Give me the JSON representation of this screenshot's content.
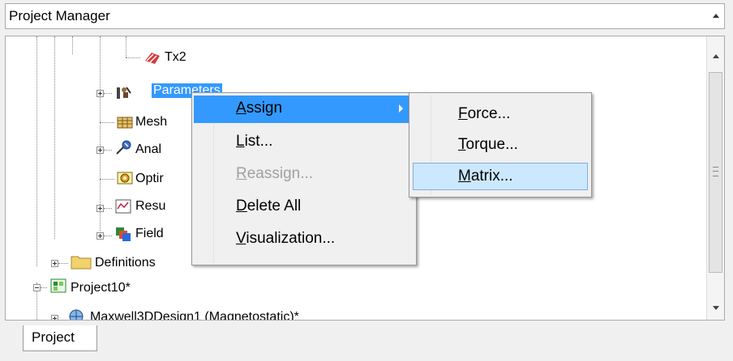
{
  "header": {
    "title": "Project Manager"
  },
  "tree": {
    "items": [
      {
        "label": "Tx2"
      },
      {
        "label": "Parameters"
      },
      {
        "label": "Mesh"
      },
      {
        "label": "Anal"
      },
      {
        "label": "Optir"
      },
      {
        "label": "Resu"
      },
      {
        "label": "Field"
      },
      {
        "label": "Definitions"
      },
      {
        "label": "Project10*"
      },
      {
        "label": "Maxwell3DDesign1 (Magnetostatic)*"
      }
    ]
  },
  "context_menu": {
    "items": [
      {
        "label": "Assign",
        "mnemonic": "A",
        "rest": "ssign",
        "state": "highlighted",
        "has_submenu": true
      },
      {
        "label": "List...",
        "mnemonic": "L",
        "rest": "ist...",
        "state": "normal"
      },
      {
        "label": "Reassign...",
        "mnemonic": "R",
        "rest": "eassign...",
        "state": "disabled"
      },
      {
        "label": "Delete All",
        "mnemonic": "D",
        "rest": "elete All",
        "state": "normal"
      },
      {
        "label": "Visualization...",
        "mnemonic": "V",
        "rest": "isualization...",
        "state": "normal"
      }
    ]
  },
  "submenu": {
    "items": [
      {
        "label": "Force...",
        "mnemonic": "F",
        "rest": "orce...",
        "state": "normal"
      },
      {
        "label": "Torque...",
        "mnemonic": "T",
        "rest": "orque...",
        "state": "normal"
      },
      {
        "label": "Matrix...",
        "mnemonic": "M",
        "rest": "atrix...",
        "state": "highlighted"
      }
    ]
  },
  "bottom_tab": {
    "label": "Project"
  },
  "colors": {
    "selection": "#3399ff",
    "menu_highlight": "#cce8ff",
    "menu_highlight_border": "#84acdd",
    "disabled_text": "#a0a0a0"
  }
}
